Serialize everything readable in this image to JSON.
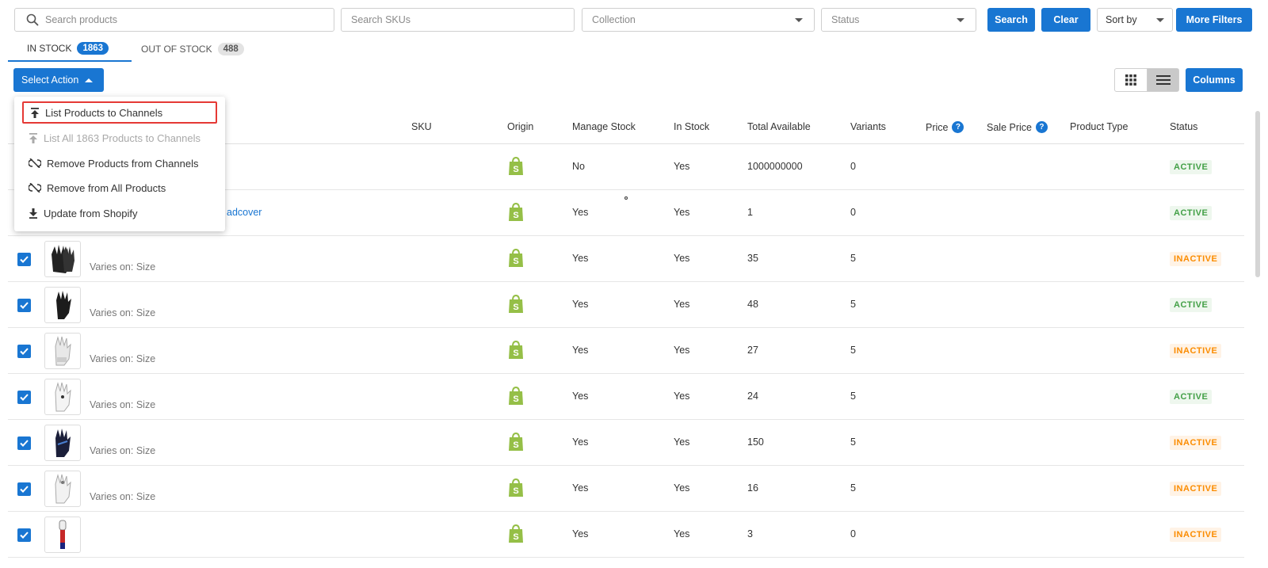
{
  "filters": {
    "search_placeholder": "Search products",
    "sku_placeholder": "Search SKUs",
    "collection_placeholder": "Collection",
    "status_placeholder": "Status",
    "search_button": "Search",
    "clear_button": "Clear",
    "sort_by": "Sort by",
    "more_filters_button": "More Filters"
  },
  "tabs": [
    {
      "label": "IN STOCK",
      "count": "1863"
    },
    {
      "label": "OUT OF STOCK",
      "count": "488"
    }
  ],
  "actions": {
    "select_action": "Select Action",
    "columns_button": "Columns"
  },
  "menu": {
    "items": [
      {
        "label": "List Products to Channels",
        "icon": "upload-icon"
      },
      {
        "label": "List All 1863 Products to Channels",
        "icon": "upload-icon"
      },
      {
        "label": "Remove Products from Channels",
        "icon": "unlink-icon"
      },
      {
        "label": "Remove from All Products",
        "icon": "unlink-icon"
      },
      {
        "label": "Update from Shopify",
        "icon": "download-icon"
      }
    ]
  },
  "table": {
    "headers": {
      "sku": "SKU",
      "origin": "Origin",
      "manage_stock": "Manage Stock",
      "in_stock": "In Stock",
      "total_available": "Total Available",
      "variants": "Variants",
      "price": "Price",
      "sale_price": "Sale Price",
      "product_type": "Product Type",
      "status": "Status"
    },
    "rows": [
      {
        "varies": "",
        "manage_stock": "No",
        "in_stock": "Yes",
        "total": "1000000000",
        "variants": "0",
        "status": "ACTIVE",
        "checked": false
      },
      {
        "varies": "",
        "link": "adcover",
        "manage_stock": "Yes",
        "in_stock": "Yes",
        "total": "1",
        "variants": "0",
        "status": "ACTIVE",
        "checked": false
      },
      {
        "varies": "Varies on: Size",
        "manage_stock": "Yes",
        "in_stock": "Yes",
        "total": "35",
        "variants": "5",
        "status": "INACTIVE",
        "checked": true
      },
      {
        "varies": "Varies on: Size",
        "manage_stock": "Yes",
        "in_stock": "Yes",
        "total": "48",
        "variants": "5",
        "status": "ACTIVE",
        "checked": true
      },
      {
        "varies": "Varies on: Size",
        "manage_stock": "Yes",
        "in_stock": "Yes",
        "total": "27",
        "variants": "5",
        "status": "INACTIVE",
        "checked": true
      },
      {
        "varies": "Varies on: Size",
        "manage_stock": "Yes",
        "in_stock": "Yes",
        "total": "24",
        "variants": "5",
        "status": "ACTIVE",
        "checked": true
      },
      {
        "varies": "Varies on: Size",
        "manage_stock": "Yes",
        "in_stock": "Yes",
        "total": "150",
        "variants": "5",
        "status": "INACTIVE",
        "checked": true
      },
      {
        "varies": "Varies on: Size",
        "manage_stock": "Yes",
        "in_stock": "Yes",
        "total": "16",
        "variants": "5",
        "status": "INACTIVE",
        "checked": true
      },
      {
        "varies": "",
        "manage_stock": "Yes",
        "in_stock": "Yes",
        "total": "3",
        "variants": "0",
        "status": "INACTIVE",
        "checked": true
      }
    ]
  },
  "colors": {
    "primary": "#1976d2",
    "active": "#43a047",
    "inactive": "#fb8c00",
    "shopify": "#95bf47",
    "highlight": "#e53935"
  }
}
